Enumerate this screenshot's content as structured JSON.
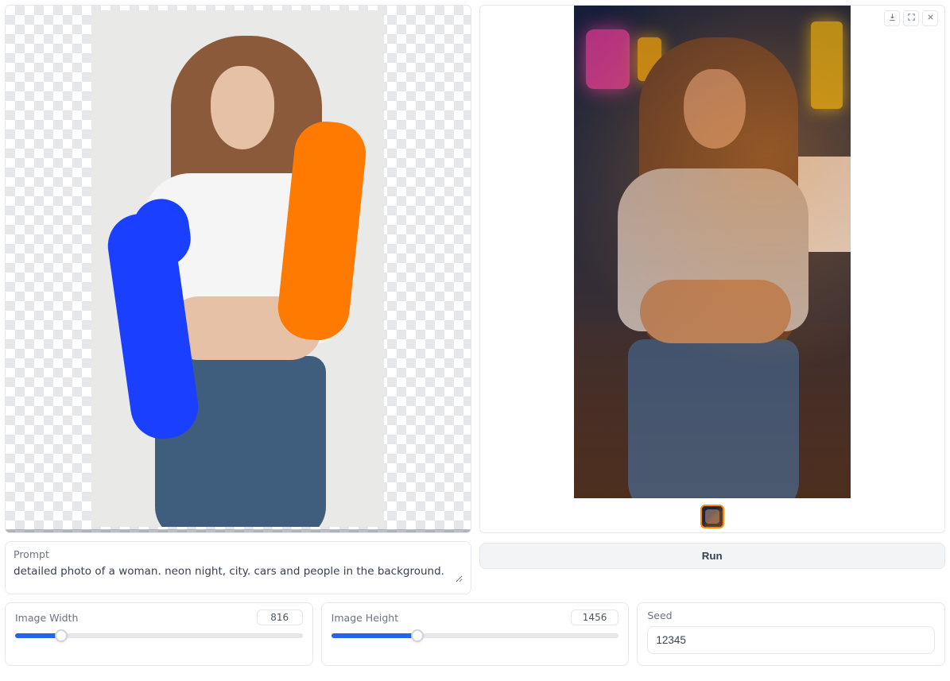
{
  "prompt": {
    "label": "Prompt",
    "value": "detailed photo of a woman. neon night, city. cars and people in the background."
  },
  "controls": {
    "width": {
      "label": "Image Width",
      "value": "816",
      "percent": 16
    },
    "height": {
      "label": "Image Height",
      "value": "1456",
      "percent": 30
    },
    "seed": {
      "label": "Seed",
      "value": "12345"
    }
  },
  "actions": {
    "run": "Run"
  },
  "canvas": {
    "strokes": [
      {
        "color": "#1b3fff"
      },
      {
        "color": "#ff7a00"
      }
    ]
  },
  "output": {
    "toolbar": {
      "download": "download-icon",
      "fullscreen": "fullscreen-icon",
      "close": "close-icon"
    }
  }
}
